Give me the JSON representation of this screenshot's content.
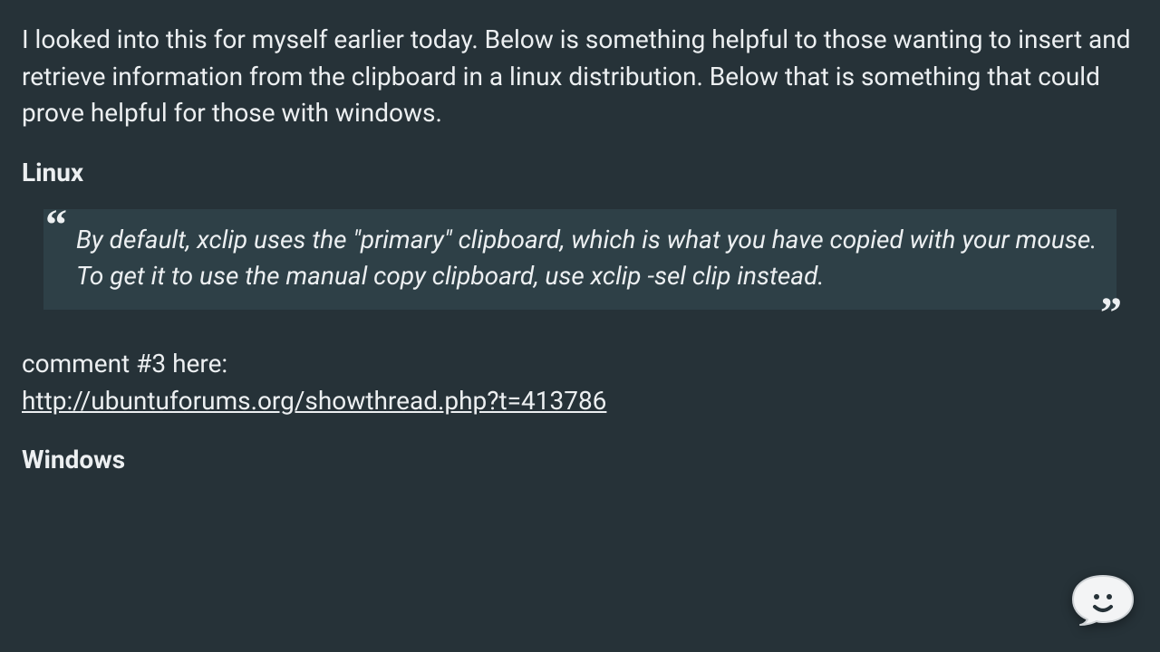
{
  "intro": "I looked into this for myself earlier today. Below is something helpful to those wanting to insert and retrieve information from the clipboard in a linux distribution. Below that is something that could prove helpful for those with windows.",
  "sections": {
    "linux": {
      "heading": "Linux",
      "quote": "By default, xclip uses the \"primary\" clipboard, which is what you have copied with your mouse. To get it to use the manual copy clipboard, use xclip -sel clip instead.",
      "comment_label": "comment #3 here:",
      "link_text": "http://ubuntuforums.org/showthread.php?t=413786"
    },
    "windows": {
      "heading": "Windows"
    }
  },
  "glyphs": {
    "open_quote": "“",
    "close_quote": "”"
  }
}
